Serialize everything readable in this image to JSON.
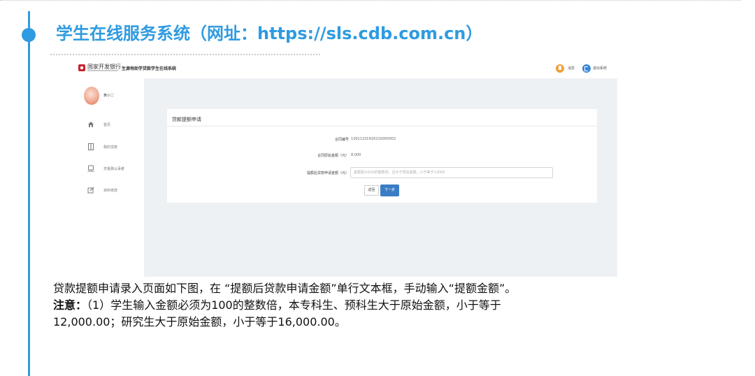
{
  "slide": {
    "title": "学生在线服务系统（网址：https://sls.cdb.com.cn）",
    "accent_color": "#2f9be0"
  },
  "screenshot": {
    "header": {
      "bank_name": "国家开发银行",
      "system_name": "生源地助学贷款学生在线系统",
      "message_label": "消息",
      "logout_label": "退出系统"
    },
    "sidebar": {
      "user_name": "黄小二",
      "items": [
        {
          "label": "首页",
          "icon": "home-icon"
        },
        {
          "label": "我的贷款",
          "icon": "loan-icon"
        },
        {
          "label": "非金融认承者",
          "icon": "certify-icon"
        },
        {
          "label": "资料修改",
          "icon": "edit-icon"
        }
      ]
    },
    "form": {
      "title": "贷款提额申请",
      "contract_label": "合同编号",
      "contract_value": "13011101H20210000002",
      "original_amount_label": "合同原始金额（元）",
      "original_amount_value": "8,000",
      "increase_label": "提额后贷款申请金额（元）",
      "increase_placeholder": "金额需为100的整数倍，且大于原始金额，小于等于12000",
      "back_button": "返回",
      "next_button": "下一步",
      "primary_color": "#3a7dc5"
    }
  },
  "description": {
    "line1": "贷款提额申请录入页面如下图，在 “提额后贷款申请金额”单行文本框，手动输入“提额金额”。",
    "note_label": "注意：",
    "note_line1": "（1）学生输入金额必须为100的整数倍，本专科生、预科生大于原始金额，小于等于",
    "note_line2": "12,000.00；研究生大于原始金额，小于等于16,000.00。"
  }
}
